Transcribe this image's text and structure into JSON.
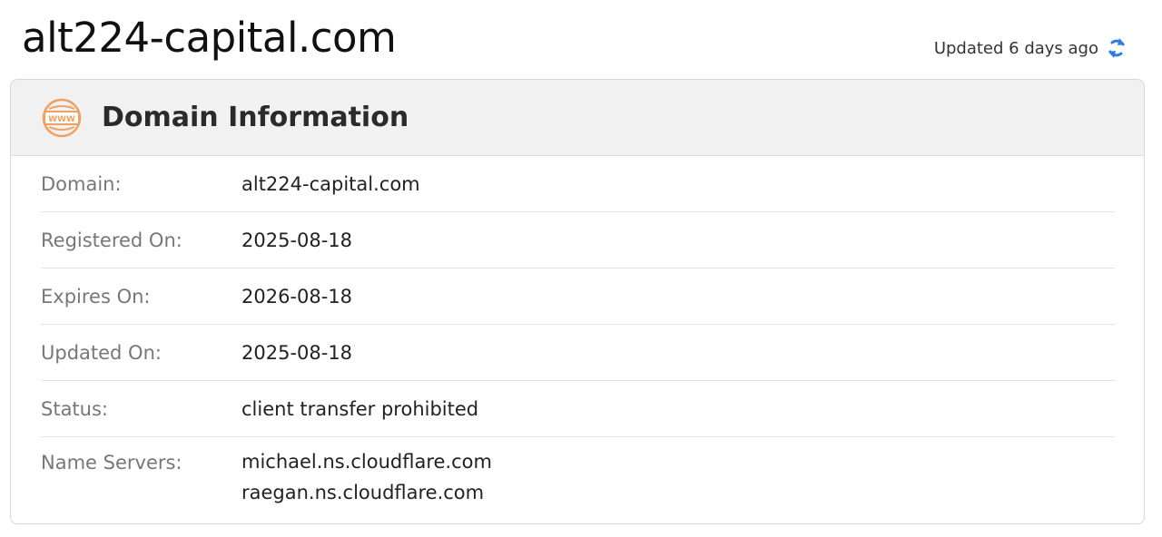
{
  "header": {
    "domain": "alt224-capital.com",
    "updated_text": "Updated 6 days ago",
    "refresh_icon": "refresh-icon"
  },
  "card": {
    "icon": "www-icon",
    "title": "Domain Information",
    "rows": {
      "domain": {
        "label": "Domain:",
        "value": "alt224-capital.com"
      },
      "registered": {
        "label": "Registered On:",
        "value": "2025-08-18"
      },
      "expires": {
        "label": "Expires On:",
        "value": "2026-08-18"
      },
      "updated": {
        "label": "Updated On:",
        "value": "2025-08-18"
      },
      "status": {
        "label": "Status:",
        "value": "client transfer prohibited"
      },
      "name_servers": {
        "label": "Name Servers:",
        "values": [
          "michael.ns.cloudflare.com",
          "raegan.ns.cloudflare.com"
        ]
      }
    }
  },
  "colors": {
    "accent_orange": "#f0a060",
    "refresh_blue": "#2f7de1"
  }
}
